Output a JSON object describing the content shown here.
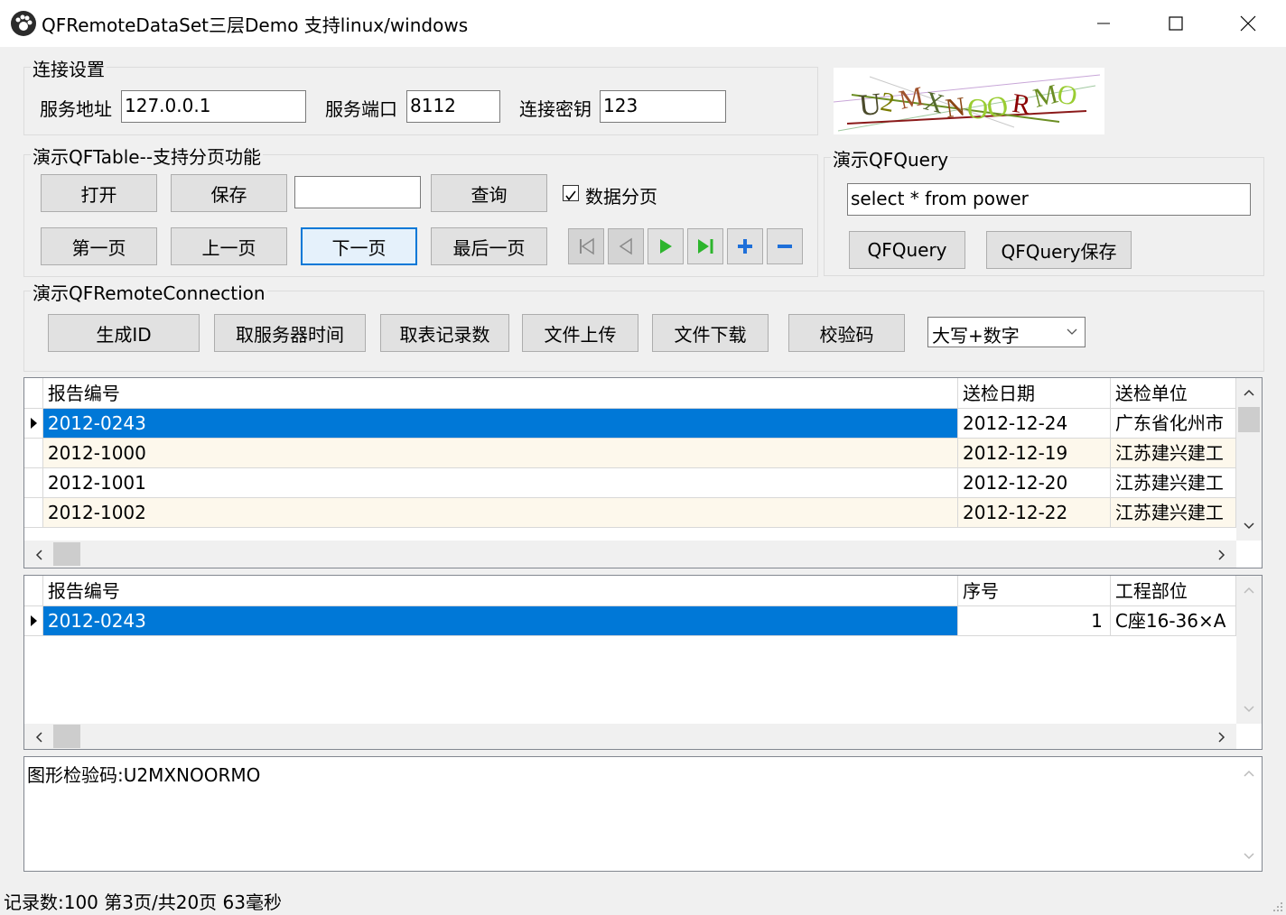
{
  "window": {
    "title": "QFRemoteDataSet三层Demo 支持linux/windows"
  },
  "connection": {
    "group_label": "连接设置",
    "address_label": "服务地址",
    "address_value": "127.0.0.1",
    "port_label": "服务端口",
    "port_value": "8112",
    "key_label": "连接密钥",
    "key_value": "123"
  },
  "captcha": {
    "text": "U2MXNOORMO"
  },
  "qftable": {
    "group_label": "演示QFTable--支持分页功能",
    "open_label": "打开",
    "save_label": "保存",
    "query_input_value": "",
    "query_label": "查询",
    "paging_checkbox_label": "数据分页",
    "paging_checked": true,
    "first_label": "第一页",
    "prev_label": "上一页",
    "next_label": "下一页",
    "last_label": "最后一页"
  },
  "qfquery": {
    "group_label": "演示QFQuery",
    "sql_value": "select * from power",
    "query_label": "QFQuery",
    "save_label": "QFQuery保存"
  },
  "remote": {
    "group_label": "演示QFRemoteConnection",
    "gen_id_label": "生成ID",
    "server_time_label": "取服务器时间",
    "record_count_label": "取表记录数",
    "upload_label": "文件上传",
    "download_label": "文件下载",
    "captcha_label": "校验码",
    "captcha_type_value": "大写+数字"
  },
  "grid1": {
    "columns": [
      "报告编号",
      "送检日期",
      "送检单位"
    ],
    "rows": [
      [
        "2012-0243",
        "2012-12-24",
        "广东省化州市"
      ],
      [
        "2012-1000",
        "2012-12-19",
        "江苏建兴建工"
      ],
      [
        "2012-1001",
        "2012-12-20",
        "江苏建兴建工"
      ],
      [
        "2012-1002",
        "2012-12-22",
        "江苏建兴建工"
      ]
    ]
  },
  "grid2": {
    "columns": [
      "报告编号",
      "序号",
      "工程部位"
    ],
    "rows": [
      [
        "2012-0243",
        "1",
        "C座16-36×A"
      ]
    ]
  },
  "log": {
    "text": "图形检验码:U2MXNOORMO"
  },
  "status": {
    "text": "记录数:100 第3页/共20页  63毫秒"
  },
  "colors": {
    "accent": "#0078d7",
    "alt_row": "#fdf8ec",
    "nav_green": "#2db52d",
    "nav_blue": "#1e6fd9"
  }
}
